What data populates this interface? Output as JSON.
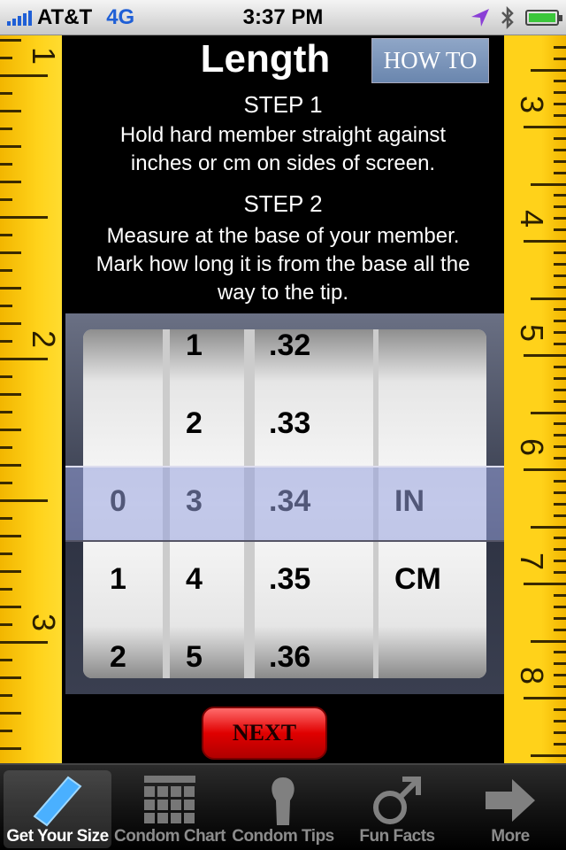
{
  "status_bar": {
    "carrier": "AT&T",
    "network": "4G",
    "time": "3:37 PM",
    "signal_bars": 5,
    "battery_level": 1.0
  },
  "rulers": {
    "left_unit": "inches",
    "left_numbers": [
      "1",
      "2",
      "3"
    ],
    "right_unit": "cm",
    "right_numbers": [
      "3",
      "4",
      "5",
      "6",
      "7",
      "8"
    ]
  },
  "header": {
    "title": "Length",
    "how_to_label": "HOW TO"
  },
  "instructions": {
    "step1_title": "STEP 1",
    "step1_line1": "Hold hard member straight against",
    "step1_line2": "inches or cm on sides of screen.",
    "step2_title": "STEP 2",
    "step2_line1": "Measure at the base of your member.",
    "step2_line2": "Mark how long it is from the base all the",
    "step2_line3": "way to the tip."
  },
  "picker": {
    "columns": [
      {
        "values": [
          "",
          "",
          "0",
          "1",
          "2"
        ],
        "selected": "0"
      },
      {
        "values": [
          "1",
          "2",
          "3",
          "4",
          "5"
        ],
        "selected": "3"
      },
      {
        "values": [
          ".32",
          ".33",
          ".34",
          ".35",
          ".36"
        ],
        "selected": ".34"
      },
      {
        "values": [
          "",
          "",
          "IN",
          "CM",
          ""
        ],
        "selected": "IN"
      }
    ]
  },
  "next_label": "NEXT",
  "tabs": [
    {
      "label": "Get Your Size",
      "icon": "ruler-icon",
      "active": true
    },
    {
      "label": "Condom Chart",
      "icon": "grid-chart-icon",
      "active": false
    },
    {
      "label": "Condom Tips",
      "icon": "bulb-icon",
      "active": false
    },
    {
      "label": "Fun Facts",
      "icon": "male-symbol-icon",
      "active": false
    },
    {
      "label": "More",
      "icon": "arrow-right-icon",
      "active": false
    }
  ],
  "colors": {
    "ruler": "#ffd21a",
    "next_button": "#e00000",
    "how_to": "#7a93b8",
    "selection": "#9aa0dc"
  }
}
